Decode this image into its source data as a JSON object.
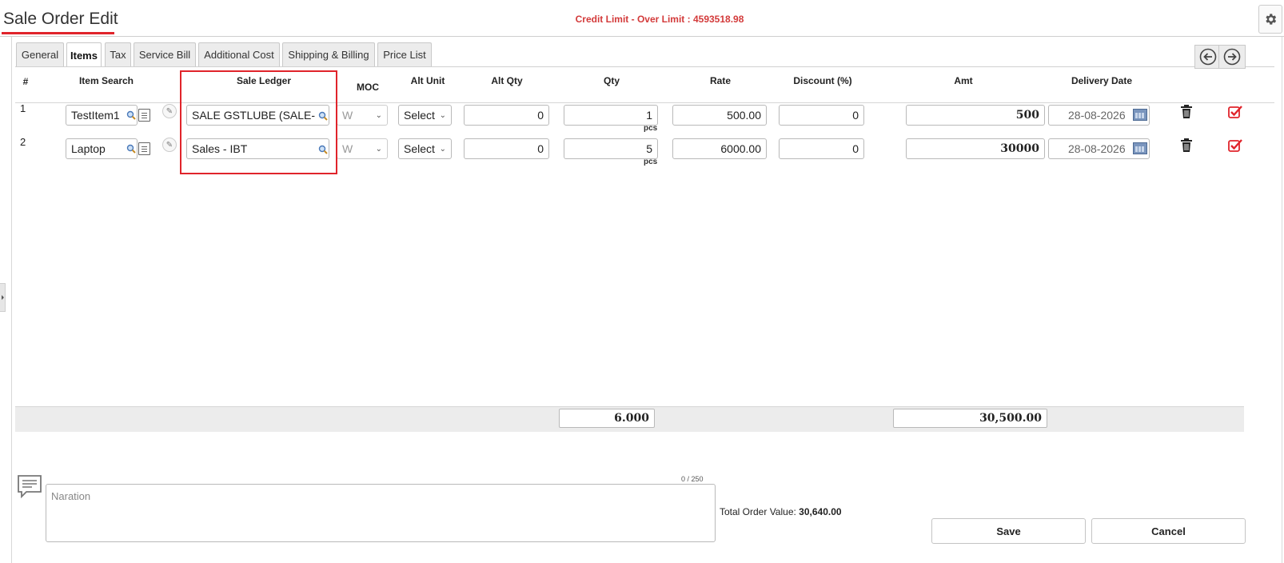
{
  "header": {
    "title": "Sale Order Edit",
    "credit_limit": "Credit Limit - Over Limit : 4593518.98",
    "icon": "gear-icon"
  },
  "tabs": [
    {
      "label": "General",
      "active": false
    },
    {
      "label": "Items",
      "active": true
    },
    {
      "label": "Tax",
      "active": false
    },
    {
      "label": "Service Bill",
      "active": false
    },
    {
      "label": "Additional Cost",
      "active": false
    },
    {
      "label": "Shipping & Billing",
      "active": false
    },
    {
      "label": "Price List",
      "active": false
    }
  ],
  "columns": {
    "num": "#",
    "item_search": "Item Search",
    "sale_ledger": "Sale Ledger",
    "moc": "MOC",
    "alt_unit": "Alt Unit",
    "alt_qty": "Alt Qty",
    "qty": "Qty",
    "rate": "Rate",
    "discount": "Discount (%)",
    "amt": "Amt",
    "delivery_date": "Delivery Date"
  },
  "rows": [
    {
      "num": "1",
      "item": "TestItem1",
      "ledger": "SALE GSTLUBE (SALE-",
      "moc": "W",
      "alt_unit": "Select",
      "alt_qty": "0",
      "qty": "1",
      "unit": "pcs",
      "rate": "500.00",
      "discount": "0",
      "amt": "500",
      "date": "28-08-2026"
    },
    {
      "num": "2",
      "item": "Laptop",
      "ledger": "Sales - IBT",
      "moc": "W",
      "alt_unit": "Select",
      "alt_qty": "0",
      "qty": "5",
      "unit": "pcs",
      "rate": "6000.00",
      "discount": "0",
      "amt": "30000",
      "date": "28-08-2026"
    }
  ],
  "totals": {
    "qty": "6.000",
    "amt": "30,500.00"
  },
  "footer": {
    "char_count": "0 / 250",
    "naration_placeholder": "Naration",
    "total_order_label": "Total Order Value:",
    "total_order_value": "30,640.00",
    "save": "Save",
    "cancel": "Cancel"
  },
  "colors": {
    "accent_red": "#e0242b",
    "credit_text": "#d33a3a",
    "check_red": "#e0242b"
  }
}
